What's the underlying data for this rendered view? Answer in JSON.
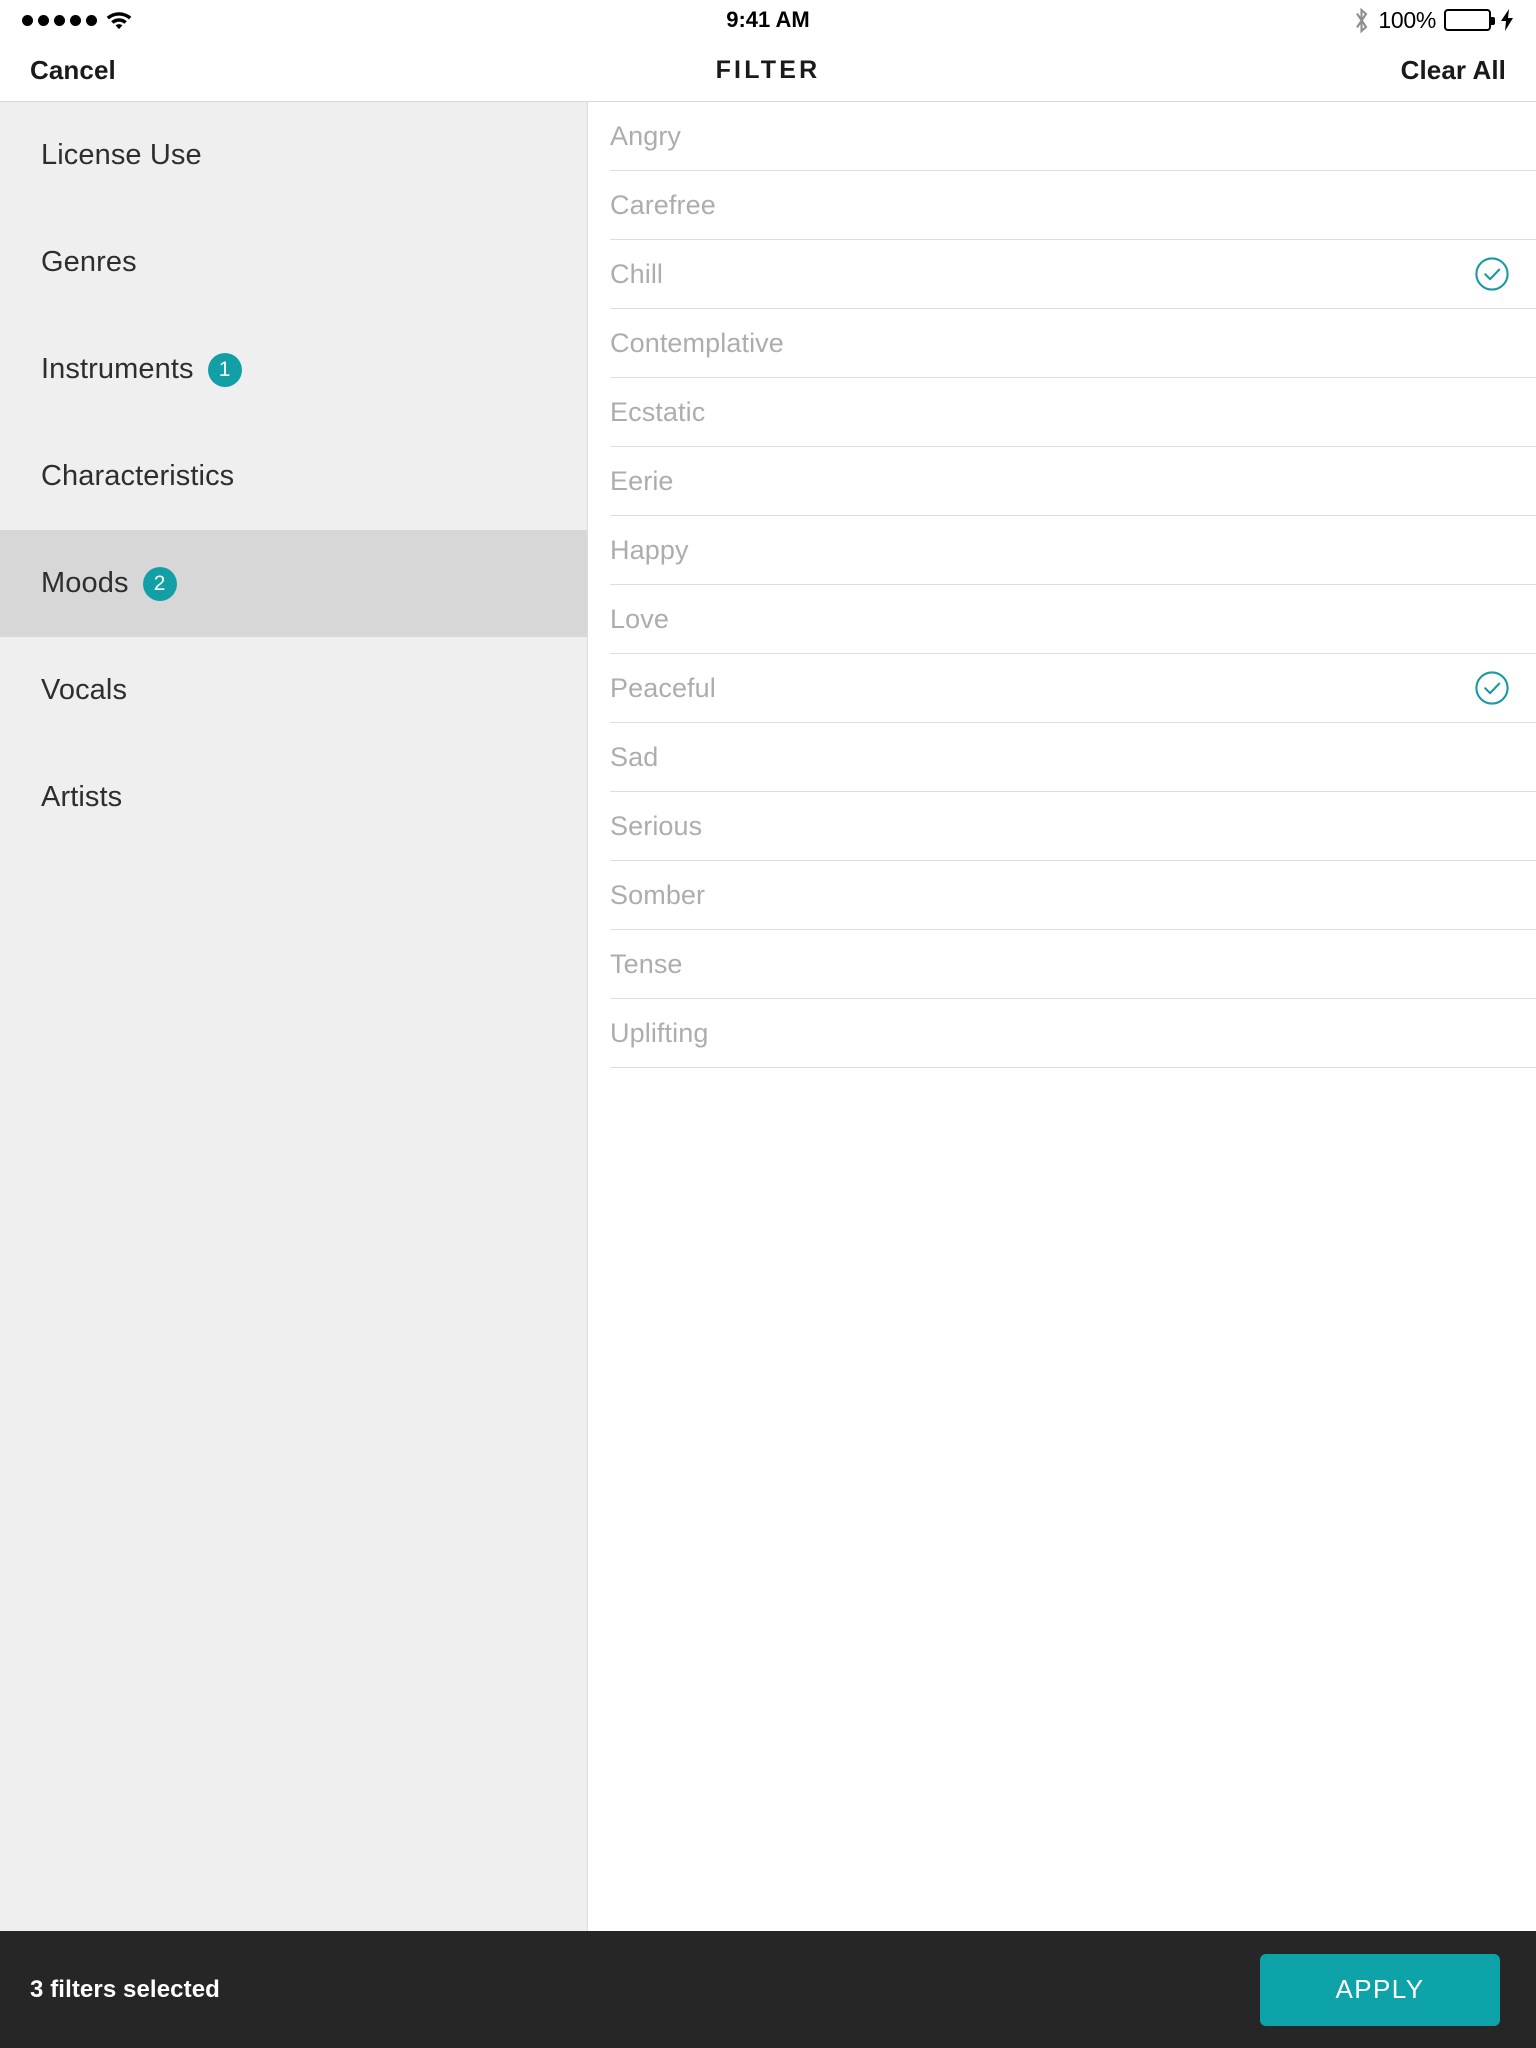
{
  "status_bar": {
    "signal_dots": 5,
    "wifi_icon": "wifi-icon",
    "time": "9:41 AM",
    "bluetooth_icon": "bluetooth-icon",
    "battery_percent": "100%",
    "charging_icon": "lightning-bolt-icon"
  },
  "nav": {
    "cancel_label": "Cancel",
    "title": "FILTER",
    "clear_all_label": "Clear All"
  },
  "sidebar": {
    "items": [
      {
        "label": "License Use",
        "badge": "",
        "active": false
      },
      {
        "label": "Genres",
        "badge": "",
        "active": false
      },
      {
        "label": "Instruments",
        "badge": "1",
        "active": false
      },
      {
        "label": "Characteristics",
        "badge": "",
        "active": false
      },
      {
        "label": "Moods",
        "badge": "2",
        "active": true
      },
      {
        "label": "Vocals",
        "badge": "",
        "active": false
      },
      {
        "label": "Artists",
        "badge": "",
        "active": false
      }
    ]
  },
  "options": {
    "items": [
      {
        "label": "Angry",
        "selected": false
      },
      {
        "label": "Carefree",
        "selected": false
      },
      {
        "label": "Chill",
        "selected": true
      },
      {
        "label": "Contemplative",
        "selected": false
      },
      {
        "label": "Ecstatic",
        "selected": false
      },
      {
        "label": "Eerie",
        "selected": false
      },
      {
        "label": "Happy",
        "selected": false
      },
      {
        "label": "Love",
        "selected": false
      },
      {
        "label": "Peaceful",
        "selected": true
      },
      {
        "label": "Sad",
        "selected": false
      },
      {
        "label": "Serious",
        "selected": false
      },
      {
        "label": "Somber",
        "selected": false
      },
      {
        "label": "Tense",
        "selected": false
      },
      {
        "label": "Uplifting",
        "selected": false
      }
    ],
    "check_icon": "check-circle-icon"
  },
  "footer": {
    "status_text": "3 filters selected",
    "apply_label": "APPLY"
  },
  "colors": {
    "accent_teal": "#0da3a8",
    "badge_teal": "#12a0a6",
    "sidebar_bg": "#efefef",
    "sidebar_active_bg": "#d7d7d7",
    "footer_bg": "#262626",
    "option_text": "#adadad",
    "battery_green": "#4cd964"
  }
}
